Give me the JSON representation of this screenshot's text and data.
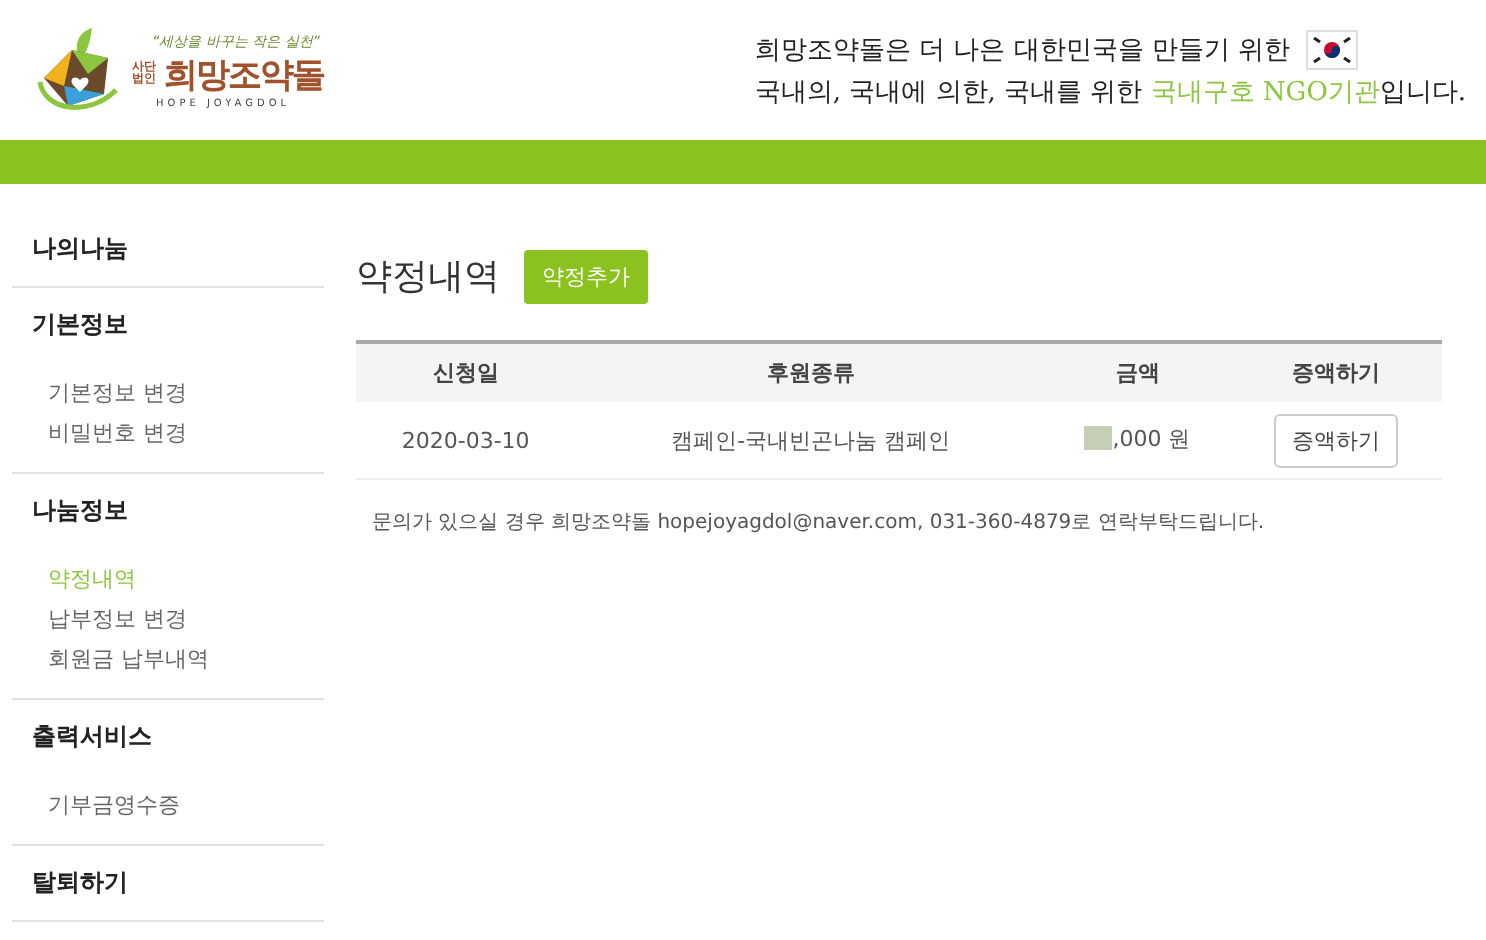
{
  "header": {
    "logo": {
      "slogan": "“세상을 바꾸는 작은 실천”",
      "org_type": "사단법인",
      "name": "희망조약돌",
      "english": "HOPE JOYAGDOL"
    },
    "tagline_1": "희망조약돌은 더 나은 대한민국을 만들기 위한",
    "tagline_2_before": "국내의, 국내에 의한, 국내를 위한 ",
    "tagline_2_highlight": "국내구호 NGO기관",
    "tagline_2_after": "입니다."
  },
  "sidebar": {
    "sections": [
      {
        "title": "나의나눔"
      },
      {
        "title": "기본정보",
        "items": [
          {
            "label": "기본정보 변경",
            "selected": false
          },
          {
            "label": "비밀번호 변경",
            "selected": false
          }
        ]
      },
      {
        "title": "나눔정보",
        "items": [
          {
            "label": "약정내역",
            "selected": true
          },
          {
            "label": "납부정보 변경",
            "selected": false
          },
          {
            "label": "회원금 납부내역",
            "selected": false
          }
        ]
      },
      {
        "title": "출력서비스",
        "items": [
          {
            "label": "기부금영수증",
            "selected": false
          }
        ]
      },
      {
        "title": "탈퇴하기"
      }
    ]
  },
  "main": {
    "title": "약정내역",
    "add_button": "약정추가",
    "table": {
      "columns": [
        "신청일",
        "후원종류",
        "금액",
        "증액하기"
      ],
      "rows": [
        {
          "date": "2020-03-10",
          "type": "캠페인-국내빈곤나눔 캠페인",
          "amount": ",000 원",
          "action": "증액하기"
        }
      ]
    },
    "notice": "문의가 있으실 경우 희망조약돌 hopejoyagdol@naver.com, 031-360-4879로 연락부탁드립니다."
  }
}
